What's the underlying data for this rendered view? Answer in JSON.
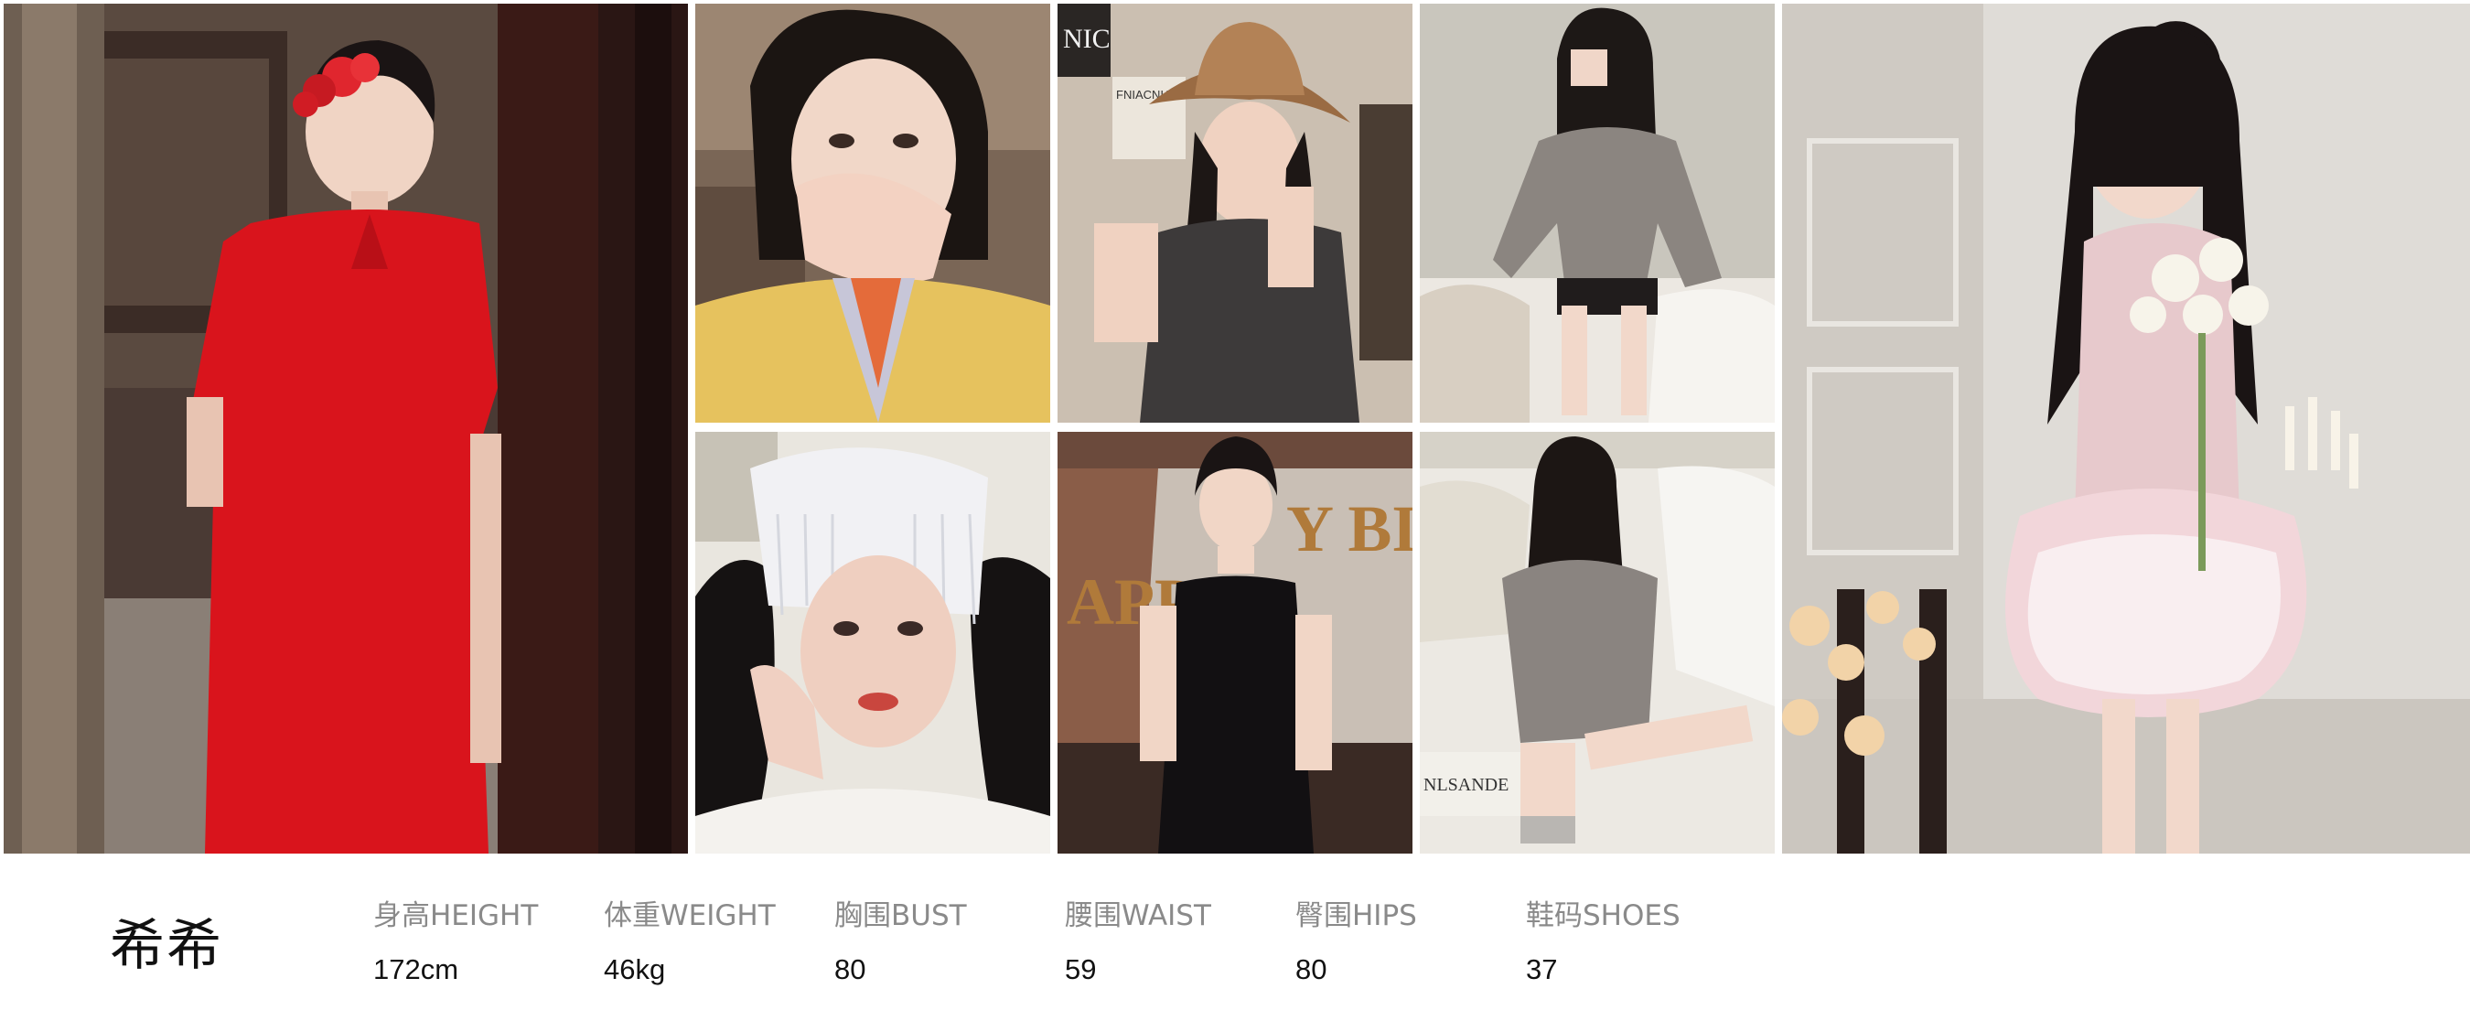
{
  "profile": {
    "name": "希希"
  },
  "measurements": [
    {
      "label": "身高HEIGHT",
      "value": "172cm"
    },
    {
      "label": "体重WEIGHT",
      "value": "46kg"
    },
    {
      "label": "胸围BUST",
      "value": "80"
    },
    {
      "label": "腰围WAIST",
      "value": "59"
    },
    {
      "label": "臀围HIPS",
      "value": "80"
    },
    {
      "label": "鞋码SHOES",
      "value": "37"
    }
  ],
  "photo_text": {
    "poster_sign": "NIC",
    "sign_small": "FNIACNIA",
    "birthday_banner_1": "Y BI",
    "birthday_banner_2": "APPY",
    "newspaper": "NLSANDE"
  },
  "colors": {
    "page_background": "#ffffff",
    "label_gray": "#8a8a8a",
    "value_black": "#111111",
    "qipao_red": "#d9141c"
  }
}
